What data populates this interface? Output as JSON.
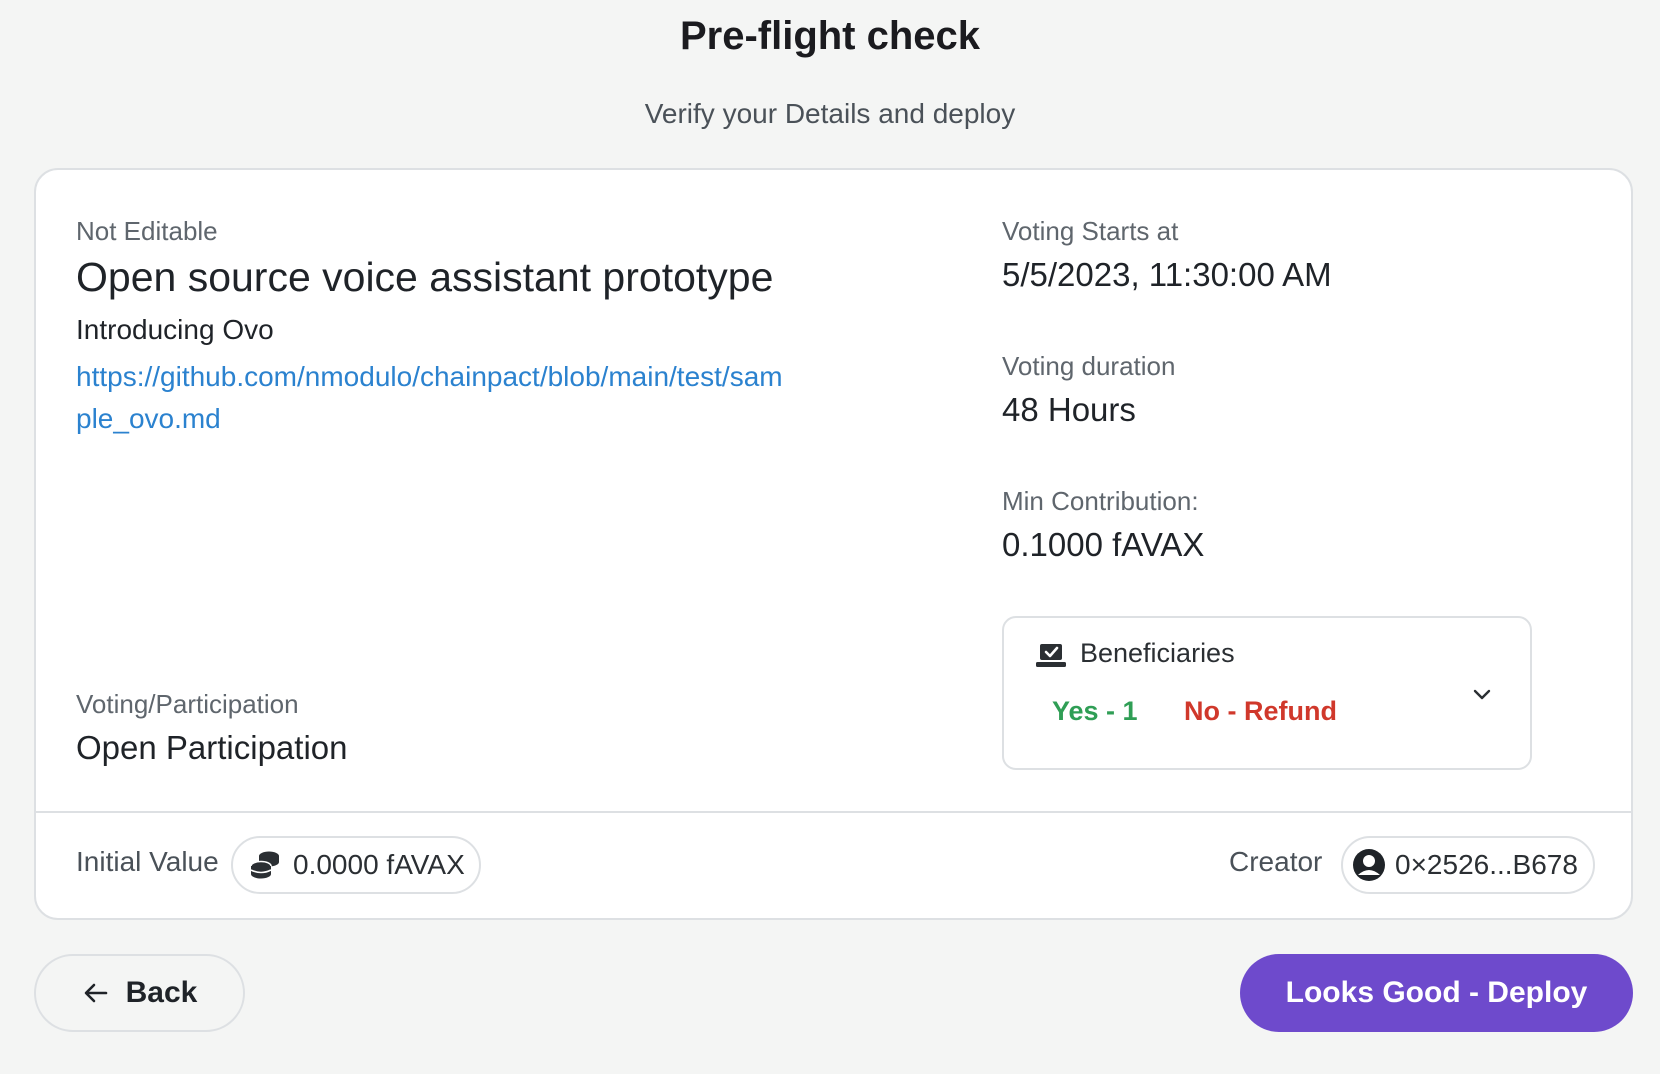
{
  "header": {
    "title": "Pre-flight check",
    "subtitle": "Verify your Details and deploy"
  },
  "proposal": {
    "editable_label": "Not Editable",
    "title": "Open source voice assistant prototype",
    "intro": "Introducing Ovo",
    "link": "https://github.com/nmodulo/chainpact/blob/main/test/sample_ovo.md",
    "voting_participation_label": "Voting/Participation",
    "voting_participation_value": "Open Participation"
  },
  "details": {
    "voting_starts_label": "Voting Starts at",
    "voting_starts_value": "5/5/2023, 11:30:00 AM",
    "voting_duration_label": "Voting duration",
    "voting_duration_value": "48 Hours",
    "min_contribution_label": "Min Contribution:",
    "min_contribution_value": "0.1000 fAVAX"
  },
  "beneficiaries": {
    "title": "Beneficiaries",
    "yes_text": "Yes - 1",
    "no_text": "No - Refund",
    "icon": "beneficiaries-icon",
    "yes_color": "#2f9e55",
    "no_color": "#d0382b"
  },
  "footer": {
    "initial_value_label": "Initial Value",
    "initial_value": "0.0000 fAVAX",
    "creator_label": "Creator",
    "creator_address": "0×2526...B678"
  },
  "actions": {
    "back_label": "Back",
    "deploy_label": "Looks Good - Deploy",
    "deploy_color": "#6e4acc"
  }
}
